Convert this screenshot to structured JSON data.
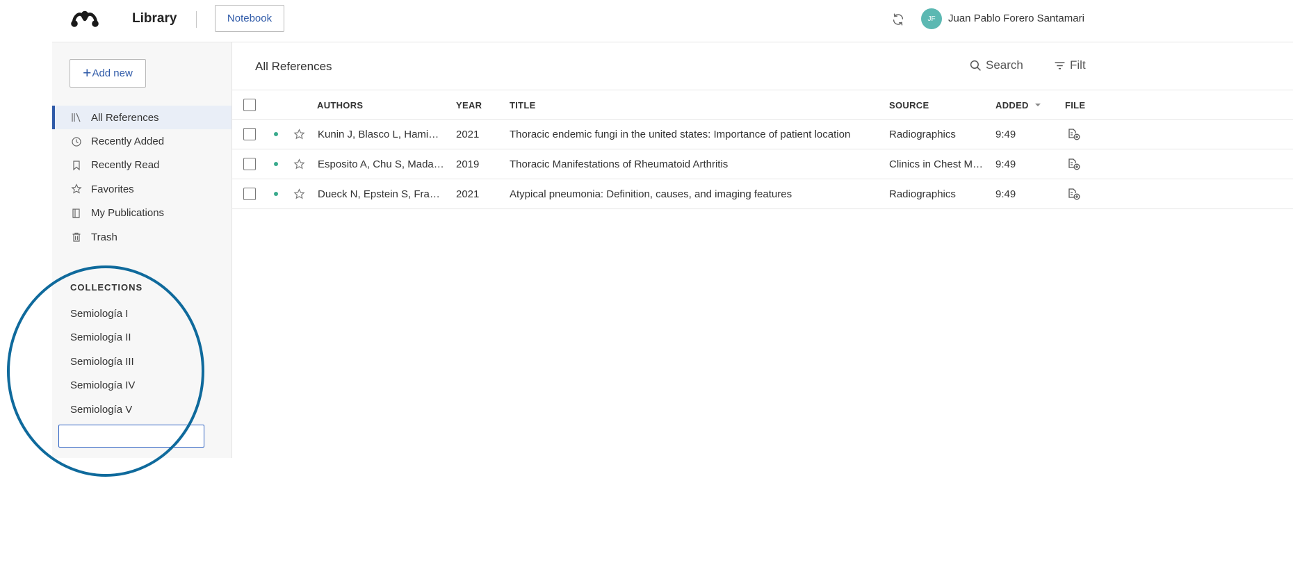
{
  "header": {
    "app_title": "Library",
    "notebook_label": "Notebook",
    "avatar_initials": "JF",
    "user_name": "Juan Pablo Forero Santamari"
  },
  "sidebar": {
    "add_new_label": "Add new",
    "nav": [
      {
        "label": "All References",
        "icon": "library-icon",
        "active": true
      },
      {
        "label": "Recently Added",
        "icon": "clock-icon",
        "active": false
      },
      {
        "label": "Recently Read",
        "icon": "bookmark-icon",
        "active": false
      },
      {
        "label": "Favorites",
        "icon": "star-icon",
        "active": false
      },
      {
        "label": "My Publications",
        "icon": "publications-icon",
        "active": false
      },
      {
        "label": "Trash",
        "icon": "trash-icon",
        "active": false
      }
    ],
    "collections_title": "COLLECTIONS",
    "collections": [
      "Semiología I",
      "Semiología II",
      "Semiología III",
      "Semiología IV",
      "Semiología V"
    ],
    "new_collection_value": ""
  },
  "main": {
    "title": "All References",
    "search_label": "Search",
    "filter_label": "Filt",
    "columns": {
      "authors": "AUTHORS",
      "year": "YEAR",
      "title": "TITLE",
      "source": "SOURCE",
      "added": "ADDED",
      "file": "FILE"
    },
    "rows": [
      {
        "authors": "Kunin J, Blasco L, Hami…",
        "year": "2021",
        "title": "Thoracic endemic fungi in the united states: Importance of patient location",
        "source": "Radiographics",
        "added": "9:49"
      },
      {
        "authors": "Esposito A, Chu S, Mada…",
        "year": "2019",
        "title": "Thoracic Manifestations of Rheumatoid Arthritis",
        "source": "Clinics in Chest M…",
        "added": "9:49"
      },
      {
        "authors": "Dueck N, Epstein S, Fra…",
        "year": "2021",
        "title": "Atypical pneumonia: Definition, causes, and imaging features",
        "source": "Radiographics",
        "added": "9:49"
      }
    ]
  },
  "colors": {
    "accent": "#2f5aa8",
    "unread_dot": "#3aaa8d",
    "avatar_bg": "#5cb8b2",
    "annotation": "#0f6a9c"
  }
}
